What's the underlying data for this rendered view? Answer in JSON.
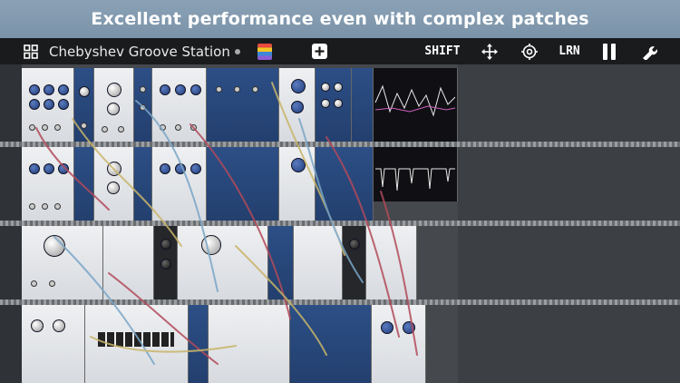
{
  "banner": {
    "text": "Excellent performance even with complex patches"
  },
  "toolbar": {
    "patch_title": "Chebyshev Groove Station",
    "shift_label": "SHIFT",
    "learn_label": "LRN"
  },
  "icons": {
    "grid": "grid-icon",
    "library": "library-icon",
    "add": "add-module-icon",
    "move": "move-icon",
    "target": "target-icon",
    "pause": "pause-icon",
    "settings": "wrench-icon"
  },
  "colors": {
    "banner": "#8aa1b6",
    "toolbar": "#1a1b1d",
    "rack": "#45484c",
    "accent_blue": "#2c4f86"
  }
}
